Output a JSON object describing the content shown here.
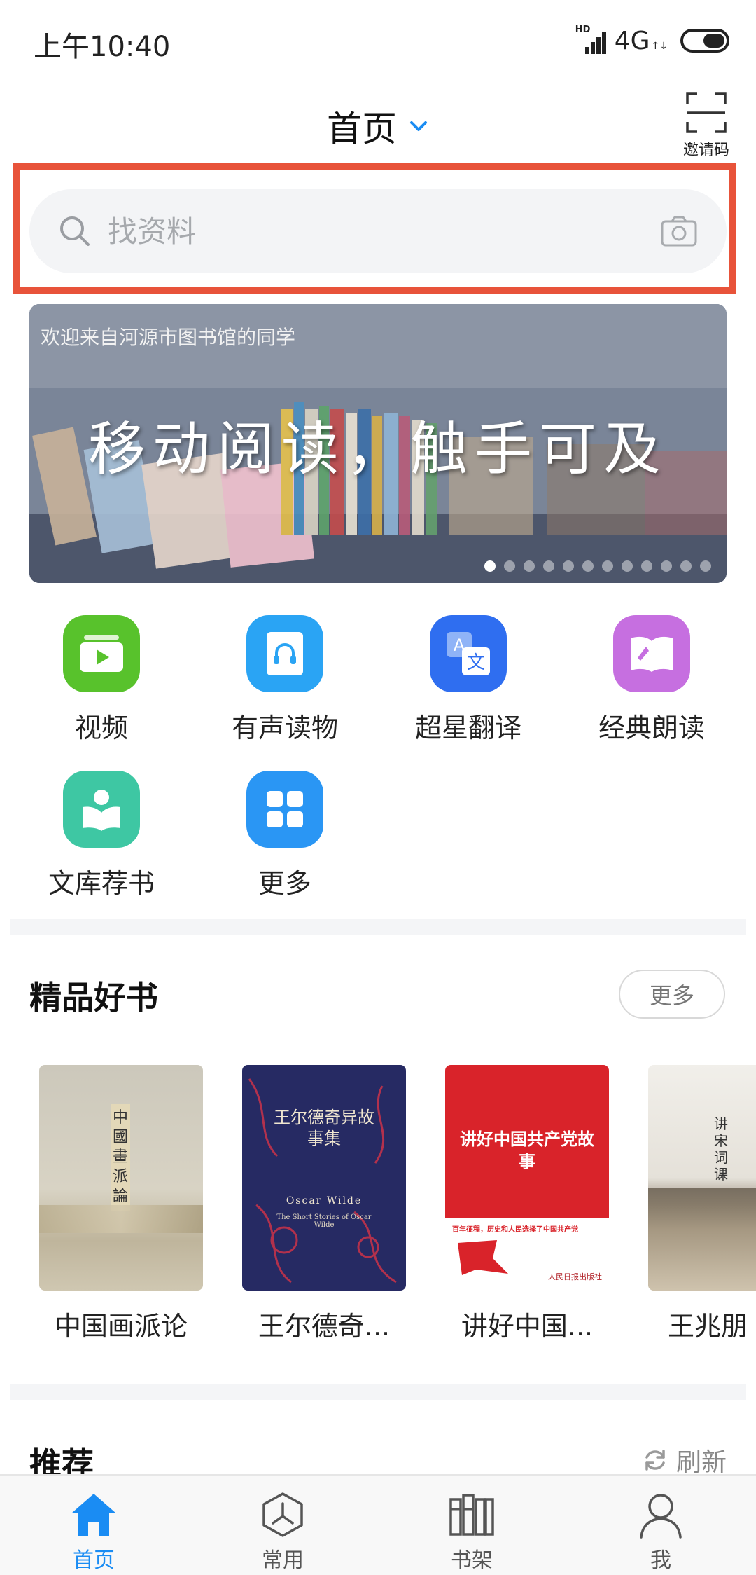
{
  "status_bar": {
    "time": "上午10:40",
    "network_type": "HD",
    "network": "4G",
    "network_arrows": "↑↓"
  },
  "header": {
    "title": "首页",
    "invite_label": "邀请码"
  },
  "search": {
    "placeholder": "找资料"
  },
  "banner": {
    "caption": "欢迎来自河源市图书馆的同学",
    "headline": "移动阅读，触手可及",
    "slide_count": 12,
    "active_slide": 1
  },
  "quick_functions": [
    {
      "label": "视频",
      "icon": "video-icon",
      "color": "#58c22c"
    },
    {
      "label": "有声读物",
      "icon": "audiobook-icon",
      "color": "#2aa4f4"
    },
    {
      "label": "超星翻译",
      "icon": "translate-icon",
      "color": "#2f6ef0"
    },
    {
      "label": "经典朗读",
      "icon": "classic-reading-icon",
      "color": "#c66fe0"
    },
    {
      "label": "文库荐书",
      "icon": "book-recommend-icon",
      "color": "#3ec7a3"
    },
    {
      "label": "更多",
      "icon": "more-grid-icon",
      "color": "#2a96f4"
    }
  ],
  "featured": {
    "title": "精品好书",
    "more_label": "更多",
    "books": [
      {
        "title": "中国画派论",
        "cover_text": "中國畫派論"
      },
      {
        "title": "王尔德奇...",
        "cover_text": "王尔德奇异故事集",
        "cover_subtext": "Oscar Wilde",
        "cover_subtext2": "The Short Stories of Oscar Wilde"
      },
      {
        "title": "讲好中国...",
        "cover_text": "讲好中国共产党故事",
        "cover_subtext": "百年征程，历史和人民选择了中国共产党",
        "cover_badge": "人民日报出版社"
      },
      {
        "title": "王兆朋",
        "cover_text": "讲宋词课"
      }
    ]
  },
  "recommend": {
    "title": "推荐",
    "refresh_label": "刷新"
  },
  "tab_bar": {
    "active_color": "#1a8cf3",
    "tabs": [
      {
        "label": "首页",
        "icon": "home-icon",
        "active": true
      },
      {
        "label": "常用",
        "icon": "common-icon",
        "active": false
      },
      {
        "label": "书架",
        "icon": "bookshelf-icon",
        "active": false
      },
      {
        "label": "我",
        "icon": "profile-icon",
        "active": false
      }
    ]
  }
}
